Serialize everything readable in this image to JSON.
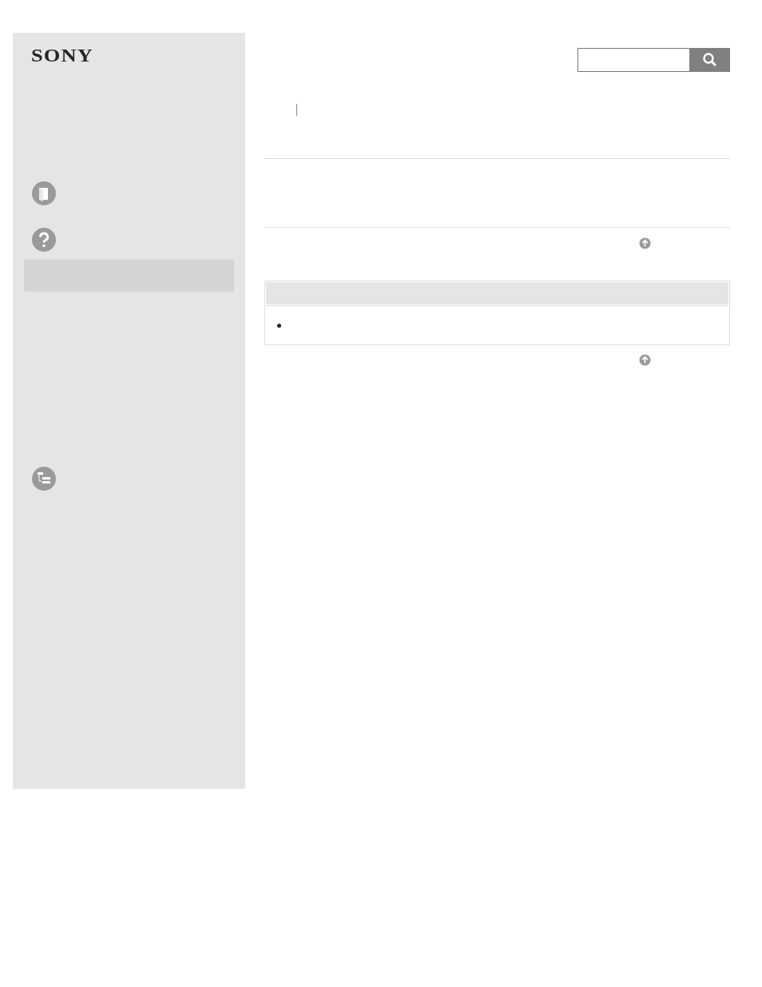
{
  "header": {
    "logo": "SONY"
  }
}
